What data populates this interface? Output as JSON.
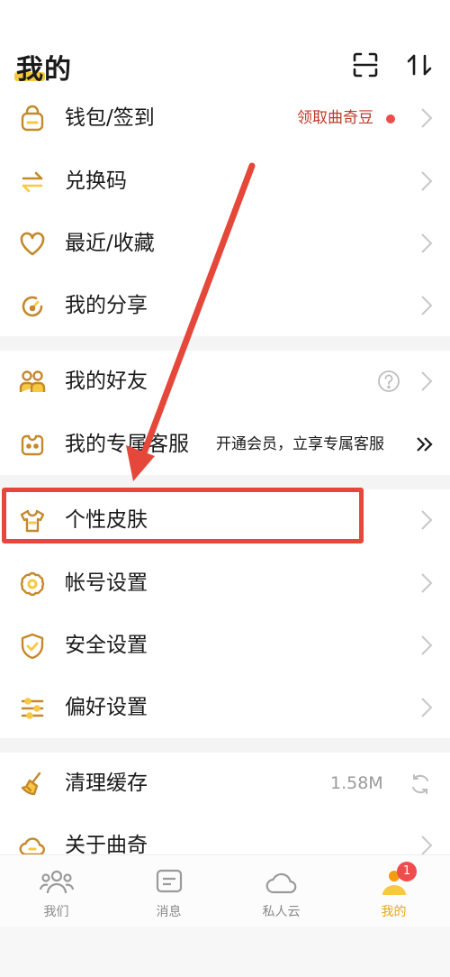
{
  "header": {
    "title": "我的",
    "scan_icon": "scan-icon",
    "sort_icon": "sort-icon"
  },
  "colors": {
    "accent": "#f7c942",
    "icon": "#c5882b",
    "alert": "#ee4d4d",
    "highlight": "#e5473a",
    "muted": "#8a8a8a"
  },
  "menu": {
    "wallet": {
      "label": "钱包/签到",
      "extra": "领取曲奇豆"
    },
    "redeem": {
      "label": "兑换码"
    },
    "recent": {
      "label": "最近/收藏"
    },
    "share": {
      "label": "我的分享"
    },
    "friends": {
      "label": "我的好友"
    },
    "service": {
      "label": "我的专属客服",
      "extra": "开通会员，立享专属客服"
    },
    "skin": {
      "label": "个性皮肤"
    },
    "account": {
      "label": "帐号设置"
    },
    "security": {
      "label": "安全设置"
    },
    "prefs": {
      "label": "偏好设置"
    },
    "cache": {
      "label": "清理缓存",
      "extra": "1.58M"
    },
    "about": {
      "label": "关于曲奇"
    }
  },
  "tabs": [
    {
      "label": "我们"
    },
    {
      "label": "消息"
    },
    {
      "label": "私人云"
    },
    {
      "label": "我的"
    }
  ],
  "badge": {
    "count": "1"
  }
}
